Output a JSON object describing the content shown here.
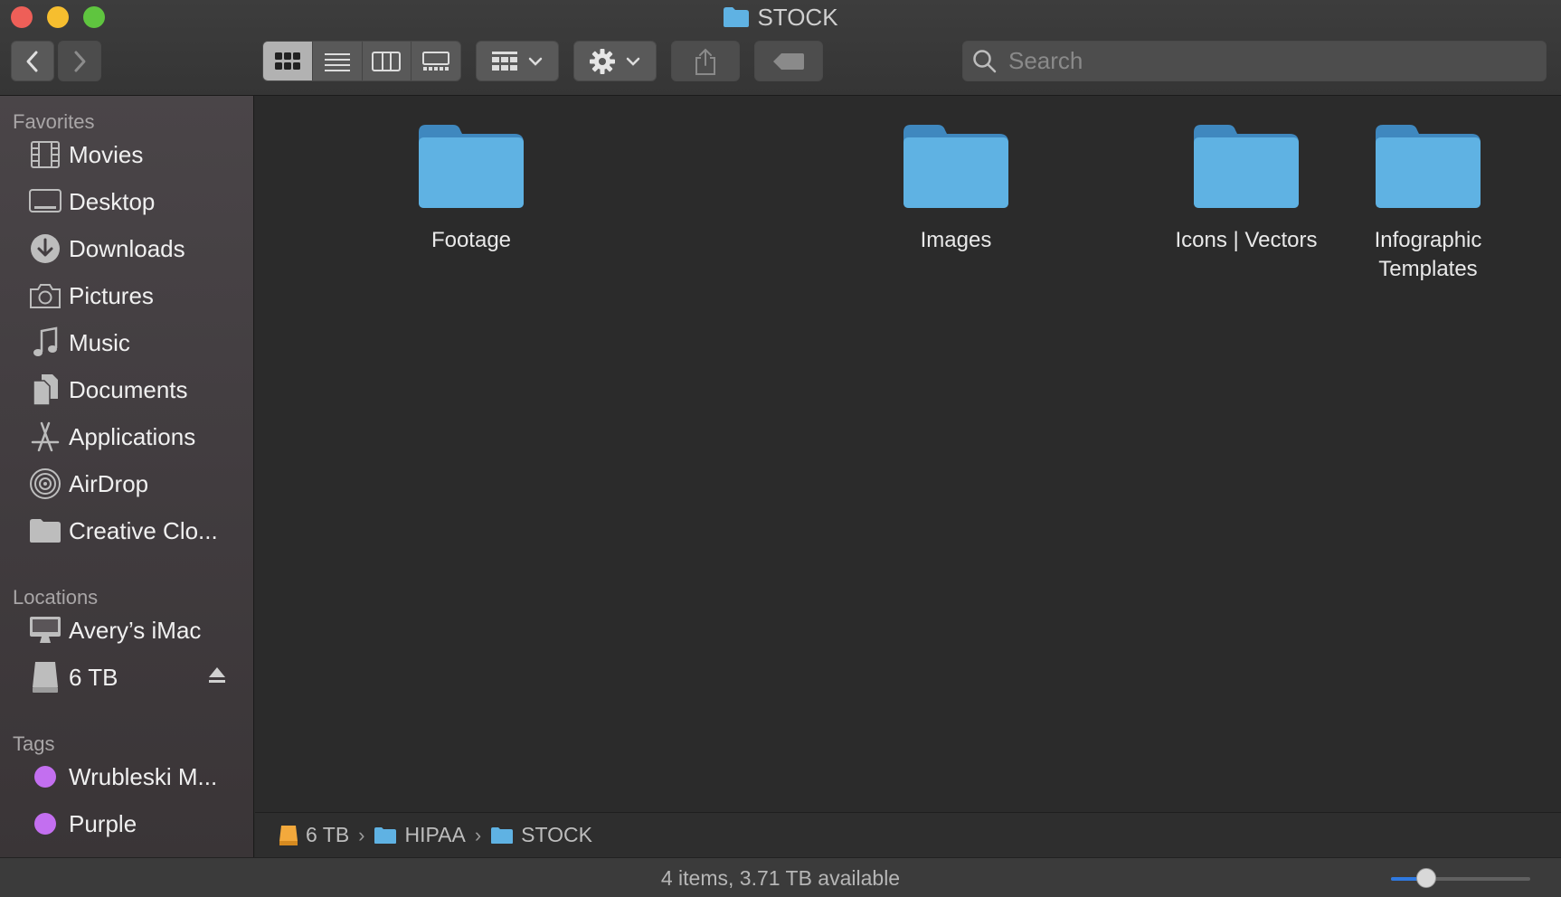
{
  "window": {
    "title": "STOCK"
  },
  "toolbar": {
    "back_icon": "chevron-left-icon",
    "forward_icon": "chevron-right-icon",
    "view_modes": [
      "icon-view",
      "list-view",
      "column-view",
      "gallery-view"
    ],
    "active_view": "icon-view",
    "search_placeholder": "Search"
  },
  "sidebar": {
    "favorites_title": "Favorites",
    "favorites": [
      {
        "label": "Movies",
        "icon": "film-icon"
      },
      {
        "label": "Desktop",
        "icon": "desktop-icon"
      },
      {
        "label": "Downloads",
        "icon": "download-icon"
      },
      {
        "label": "Pictures",
        "icon": "camera-icon"
      },
      {
        "label": "Music",
        "icon": "music-note-icon"
      },
      {
        "label": "Documents",
        "icon": "document-icon"
      },
      {
        "label": "Applications",
        "icon": "applications-icon"
      },
      {
        "label": "AirDrop",
        "icon": "airdrop-icon"
      },
      {
        "label": "Creative Clo...",
        "icon": "folder-icon"
      }
    ],
    "locations_title": "Locations",
    "locations": [
      {
        "label": "Avery’s iMac",
        "icon": "imac-icon"
      },
      {
        "label": "6 TB",
        "icon": "drive-icon"
      }
    ],
    "tags_title": "Tags",
    "tags": [
      {
        "label": "Wrubleski M...",
        "color": "#c36ff0"
      },
      {
        "label": "Purple",
        "color": "#c36ff0"
      }
    ]
  },
  "items": [
    {
      "name": "Footage"
    },
    {
      "name": "Images"
    },
    {
      "name": "Icons | Vectors"
    },
    {
      "name": "Infographic Templates"
    }
  ],
  "pathbar": {
    "crumbs": [
      "6 TB",
      "HIPAA",
      "STOCK"
    ]
  },
  "statusbar": {
    "text": "4 items, 3.71 TB available",
    "icon_size_level": 0.25
  },
  "colors": {
    "folder_blue": "#5fb2e3",
    "tag_purple": "#c36ff0",
    "slider_accent": "#2f79e0"
  }
}
